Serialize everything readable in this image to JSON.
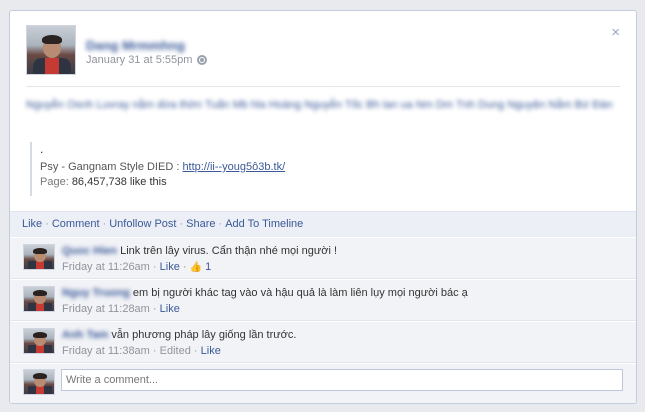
{
  "post": {
    "author_name": "Dang Mrmmhng",
    "timestamp": "January 31 at 5:55pm",
    "privacy_icon": "globe-icon",
    "message": "Nguyễn Osnh Luvray nằm dừa thờn Tuấn Mb hla Hoàng Nguyễn Tốc Bh lan ua Nm Dm Tnh Dung Nguyện Nắm Bứ Đàn",
    "shared": {
      "bullet": ".",
      "title_prefix": "Psy - Gangnam Style DIED : ",
      "link": "http://ii--youg5ô3b.tk/",
      "page_label": "Page: ",
      "page_value": "86,457,738 like this"
    }
  },
  "actions": {
    "like": "Like",
    "comment": "Comment",
    "unfollow": "Unfollow Post",
    "share": "Share",
    "timeline": "Add To Timeline",
    "sep": "·"
  },
  "comments": [
    {
      "author": "Quoc Hien",
      "text": "Link trên lây virus. Cẩn thận nhé mọi người !",
      "time": "Friday at 11:26am",
      "sep": "·",
      "like": "Like",
      "sep2": "·",
      "likes": "1"
    },
    {
      "author": "Nguy Truong",
      "text": "em bị người khác tag vào và hậu quả là làm liên lụy mọi người bác ạ",
      "time": "Friday at 11:28am",
      "sep": "·",
      "like": "Like"
    },
    {
      "author": "Anh Tam",
      "text": "vẫn phương pháp lây giống lần trước.",
      "time": "Friday at 11:38am",
      "sep": "·",
      "edited": "Edited",
      "sep2": "·",
      "like": "Like"
    }
  ],
  "write_comment": {
    "placeholder": "Write a comment..."
  },
  "close_symbol": "×",
  "thumb_symbol": "👍"
}
